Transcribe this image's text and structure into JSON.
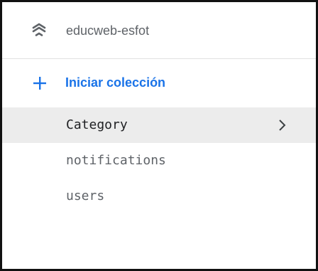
{
  "project": {
    "name": "educweb-esfot",
    "icon": "firestore-stack-icon"
  },
  "add_collection": {
    "label": "Iniciar colección",
    "icon": "plus-icon",
    "color": "#1a73e8"
  },
  "collections": [
    {
      "label": "Category",
      "selected": true,
      "icon": "chevron-right-icon"
    },
    {
      "label": "notifications",
      "selected": false
    },
    {
      "label": "users",
      "selected": false
    }
  ],
  "colors": {
    "selected_bg": "#ececec",
    "muted_text": "#5f6368",
    "divider": "#e0e0e0"
  }
}
